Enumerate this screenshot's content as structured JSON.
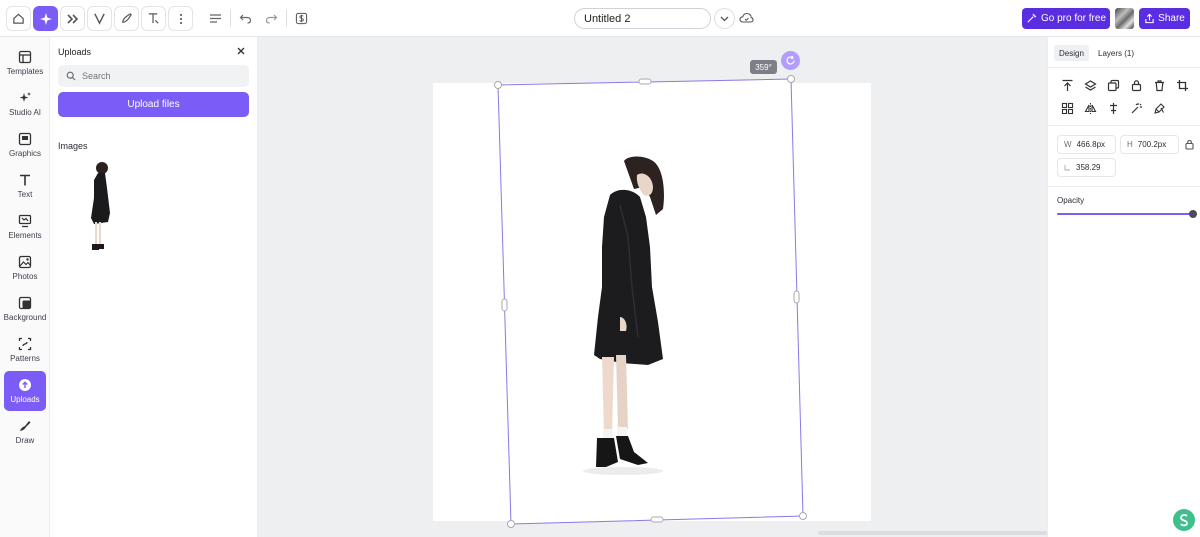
{
  "topbar": {
    "document_title": "Untitled 2",
    "go_pro_label": "Go pro for free",
    "share_label": "Share",
    "icons": [
      "home-icon",
      "sparkle-icon",
      "double-chevron-icon",
      "v-logo-icon",
      "paint-icon",
      "text-effect-icon",
      "more-vertical-icon",
      "menu-lines-icon",
      "undo-icon",
      "redo-icon",
      "dollar-icon",
      "chevron-down-icon",
      "cloud-sync-icon"
    ]
  },
  "rail": {
    "items": [
      {
        "label": "Templates",
        "icon": "templates-icon"
      },
      {
        "label": "Studio AI",
        "icon": "sparkle-icon"
      },
      {
        "label": "Graphics",
        "icon": "graphics-icon"
      },
      {
        "label": "Text",
        "icon": "text-icon"
      },
      {
        "label": "Elements",
        "icon": "elements-icon"
      },
      {
        "label": "Photos",
        "icon": "photo-icon"
      },
      {
        "label": "Background",
        "icon": "background-icon"
      },
      {
        "label": "Patterns",
        "icon": "patterns-icon"
      },
      {
        "label": "Uploads",
        "icon": "upload-icon"
      },
      {
        "label": "Draw",
        "icon": "draw-icon"
      }
    ],
    "active": "Uploads"
  },
  "uploads_panel": {
    "title": "Uploads",
    "search_placeholder": "Search",
    "upload_button": "Upload files",
    "images_heading": "Images"
  },
  "canvas": {
    "rotation_badge": "359°"
  },
  "design_panel": {
    "tabs": [
      "Design",
      "Layers (1)"
    ],
    "active_tab": "Design",
    "width_key": "W",
    "width_value": "466.8px",
    "height_key": "H",
    "height_value": "700.2px",
    "rotation_value": "358.29",
    "opacity_label": "Opacity",
    "opacity_value": 1.0
  },
  "colors": {
    "accent": "#7b5cf6",
    "pro": "#5a2ee0"
  }
}
